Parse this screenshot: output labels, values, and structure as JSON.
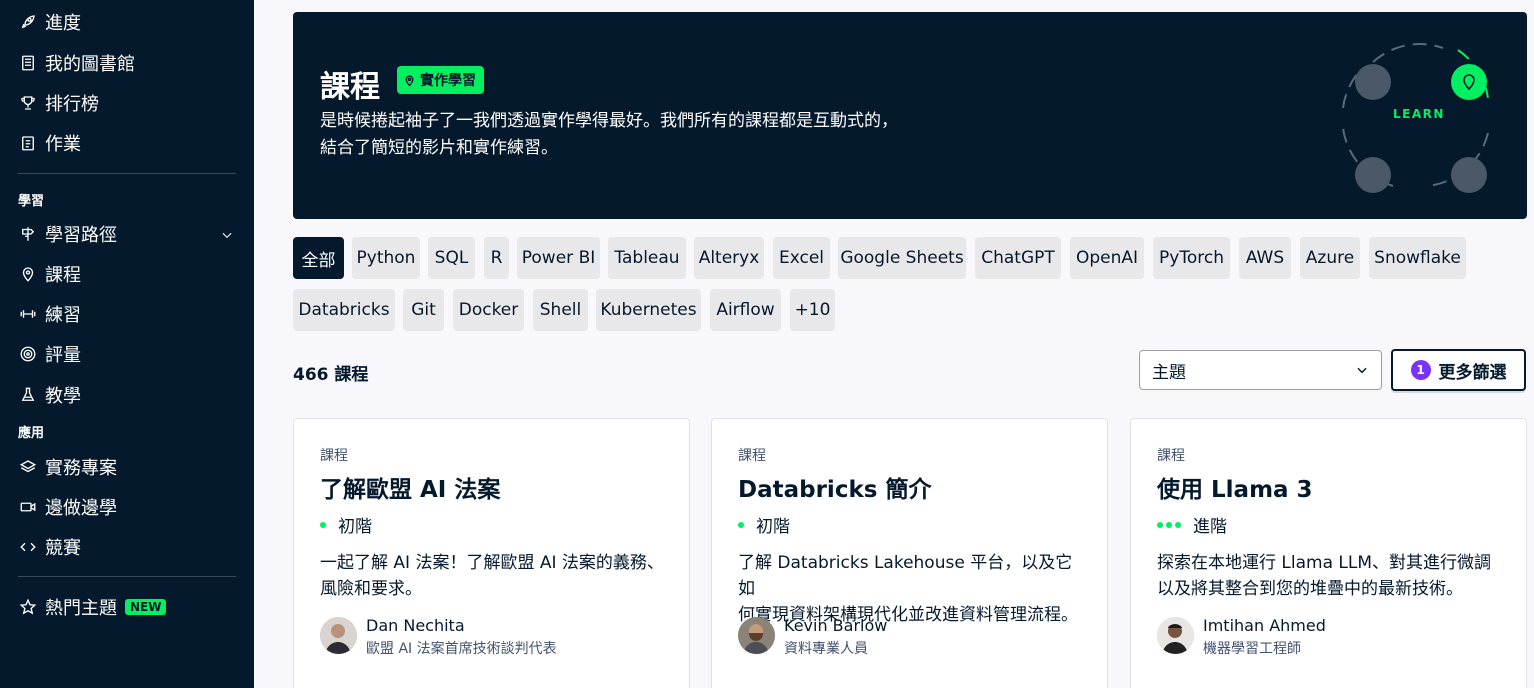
{
  "sidebar": {
    "top_items": [
      {
        "label": "進度",
        "icon": "rocket-icon"
      },
      {
        "label": "我的圖書館",
        "icon": "book-icon"
      },
      {
        "label": "排行榜",
        "icon": "trophy-icon"
      },
      {
        "label": "作業",
        "icon": "clipboard-icon"
      }
    ],
    "section_learn": "學習",
    "learn_items": [
      {
        "label": "學習路徑",
        "icon": "signpost-icon"
      },
      {
        "label": "課程",
        "icon": "location-pin-icon"
      },
      {
        "label": "練習",
        "icon": "dumbbell-icon"
      },
      {
        "label": "評量",
        "icon": "target-icon"
      },
      {
        "label": "教學",
        "icon": "flask-icon"
      }
    ],
    "section_apply": "應用",
    "apply_items": [
      {
        "label": "實務專案",
        "icon": "layers-icon"
      },
      {
        "label": "邊做邊學",
        "icon": "video-icon"
      },
      {
        "label": "競賽",
        "icon": "code-icon"
      }
    ],
    "trending": {
      "label": "熱門主題",
      "badge": "NEW",
      "icon": "star-icon"
    }
  },
  "hero": {
    "title": "課程",
    "tag": "實作學習",
    "description_line1": "是時候捲起袖子了一我們透過實作學得最好。我們所有的課程都是互動式的，",
    "description_line2": "結合了簡短的影片和實作練習。",
    "cycle_label": "LEARN"
  },
  "filters": [
    "全部",
    "Python",
    "SQL",
    "R",
    "Power BI",
    "Tableau",
    "Alteryx",
    "Excel",
    "Google Sheets",
    "ChatGPT",
    "OpenAI",
    "PyTorch",
    "AWS",
    "Azure",
    "Snowflake",
    "Databricks",
    "Git",
    "Docker",
    "Shell",
    "Kubernetes",
    "Airflow",
    "+10"
  ],
  "results": {
    "count": "466 課程",
    "topic_select": "主題",
    "more_filters_count": "1",
    "more_filters_label": "更多篩選"
  },
  "cards": [
    {
      "kind": "課程",
      "title": "了解歐盟 AI 法案",
      "level": "初階",
      "level_dots": 1,
      "desc_line1": "一起了解 AI 法案！了解歐盟 AI 法案的義務、",
      "desc_line2": "風險和要求。",
      "author": "Dan Nechita",
      "role": "歐盟 AI 法案首席技術談判代表"
    },
    {
      "kind": "課程",
      "title": "Databricks 簡介",
      "level": "初階",
      "level_dots": 1,
      "desc_line1": "了解 Databricks Lakehouse 平台，以及它如",
      "desc_line2": "何實現資料架構現代化並改進資料管理流程。",
      "author": "Kevin Barlow",
      "role": "資料專業人員"
    },
    {
      "kind": "課程",
      "title": "使用 Llama 3",
      "level": "進階",
      "level_dots": 3,
      "desc_line1": "探索在本地運行 Llama LLM、對其進行微調",
      "desc_line2": "以及將其整合到您的堆疊中的最新技術。",
      "author": "Imtihan Ahmed",
      "role": "機器學習工程師"
    }
  ],
  "colors": {
    "navy": "#05192d",
    "green": "#03ef62",
    "purple": "#7933ff"
  }
}
